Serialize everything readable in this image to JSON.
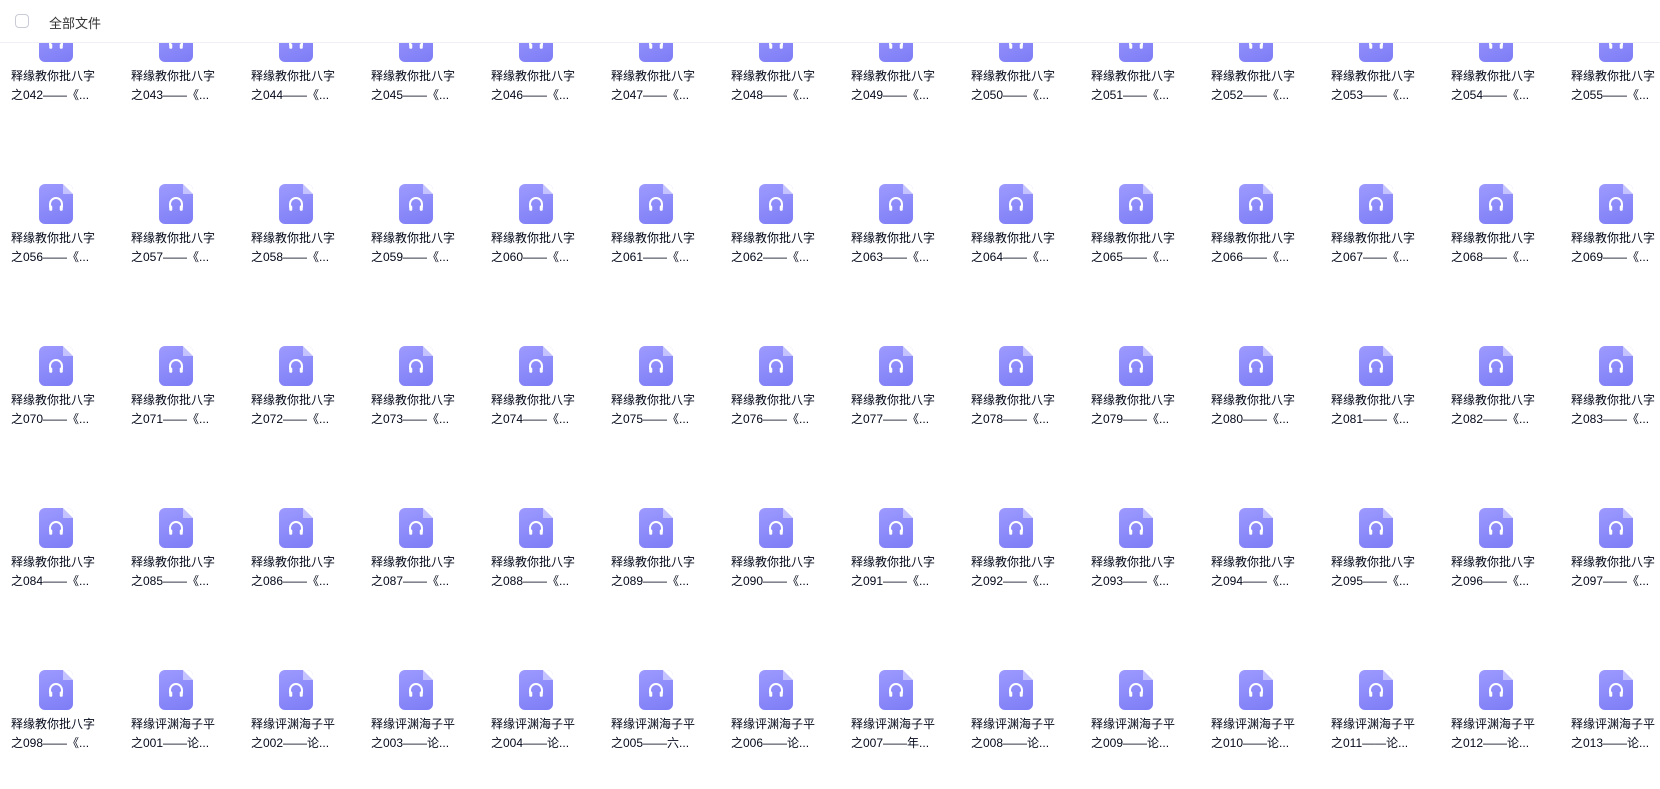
{
  "header": {
    "title": "全部文件"
  },
  "icon_name": "headphones-audio-icon",
  "colors": {
    "icon": "#8a89fb",
    "text": "#03081a",
    "border": "#eef0f5"
  },
  "files": [
    {
      "l1": "释缘教你批八字",
      "l2": "之042——《..."
    },
    {
      "l1": "释缘教你批八字",
      "l2": "之043——《..."
    },
    {
      "l1": "释缘教你批八字",
      "l2": "之044——《..."
    },
    {
      "l1": "释缘教你批八字",
      "l2": "之045——《..."
    },
    {
      "l1": "释缘教你批八字",
      "l2": "之046——《..."
    },
    {
      "l1": "释缘教你批八字",
      "l2": "之047——《..."
    },
    {
      "l1": "释缘教你批八字",
      "l2": "之048——《..."
    },
    {
      "l1": "释缘教你批八字",
      "l2": "之049——《..."
    },
    {
      "l1": "释缘教你批八字",
      "l2": "之050——《..."
    },
    {
      "l1": "释缘教你批八字",
      "l2": "之051——《..."
    },
    {
      "l1": "释缘教你批八字",
      "l2": "之052——《..."
    },
    {
      "l1": "释缘教你批八字",
      "l2": "之053——《..."
    },
    {
      "l1": "释缘教你批八字",
      "l2": "之054——《..."
    },
    {
      "l1": "释缘教你批八字",
      "l2": "之055——《..."
    },
    {
      "l1": "释缘教你批八字",
      "l2": "之056——《..."
    },
    {
      "l1": "释缘教你批八字",
      "l2": "之057——《..."
    },
    {
      "l1": "释缘教你批八字",
      "l2": "之058——《..."
    },
    {
      "l1": "释缘教你批八字",
      "l2": "之059——《..."
    },
    {
      "l1": "释缘教你批八字",
      "l2": "之060——《..."
    },
    {
      "l1": "释缘教你批八字",
      "l2": "之061——《..."
    },
    {
      "l1": "释缘教你批八字",
      "l2": "之062——《..."
    },
    {
      "l1": "释缘教你批八字",
      "l2": "之063——《..."
    },
    {
      "l1": "释缘教你批八字",
      "l2": "之064——《..."
    },
    {
      "l1": "释缘教你批八字",
      "l2": "之065——《..."
    },
    {
      "l1": "释缘教你批八字",
      "l2": "之066——《..."
    },
    {
      "l1": "释缘教你批八字",
      "l2": "之067——《..."
    },
    {
      "l1": "释缘教你批八字",
      "l2": "之068——《..."
    },
    {
      "l1": "释缘教你批八字",
      "l2": "之069——《..."
    },
    {
      "l1": "释缘教你批八字",
      "l2": "之070——《..."
    },
    {
      "l1": "释缘教你批八字",
      "l2": "之071——《..."
    },
    {
      "l1": "释缘教你批八字",
      "l2": "之072——《..."
    },
    {
      "l1": "释缘教你批八字",
      "l2": "之073——《..."
    },
    {
      "l1": "释缘教你批八字",
      "l2": "之074——《..."
    },
    {
      "l1": "释缘教你批八字",
      "l2": "之075——《..."
    },
    {
      "l1": "释缘教你批八字",
      "l2": "之076——《..."
    },
    {
      "l1": "释缘教你批八字",
      "l2": "之077——《..."
    },
    {
      "l1": "释缘教你批八字",
      "l2": "之078——《..."
    },
    {
      "l1": "释缘教你批八字",
      "l2": "之079——《..."
    },
    {
      "l1": "释缘教你批八字",
      "l2": "之080——《..."
    },
    {
      "l1": "释缘教你批八字",
      "l2": "之081——《..."
    },
    {
      "l1": "释缘教你批八字",
      "l2": "之082——《..."
    },
    {
      "l1": "释缘教你批八字",
      "l2": "之083——《..."
    },
    {
      "l1": "释缘教你批八字",
      "l2": "之084——《..."
    },
    {
      "l1": "释缘教你批八字",
      "l2": "之085——《..."
    },
    {
      "l1": "释缘教你批八字",
      "l2": "之086——《..."
    },
    {
      "l1": "释缘教你批八字",
      "l2": "之087——《..."
    },
    {
      "l1": "释缘教你批八字",
      "l2": "之088——《..."
    },
    {
      "l1": "释缘教你批八字",
      "l2": "之089——《..."
    },
    {
      "l1": "释缘教你批八字",
      "l2": "之090——《..."
    },
    {
      "l1": "释缘教你批八字",
      "l2": "之091——《..."
    },
    {
      "l1": "释缘教你批八字",
      "l2": "之092——《..."
    },
    {
      "l1": "释缘教你批八字",
      "l2": "之093——《..."
    },
    {
      "l1": "释缘教你批八字",
      "l2": "之094——《..."
    },
    {
      "l1": "释缘教你批八字",
      "l2": "之095——《..."
    },
    {
      "l1": "释缘教你批八字",
      "l2": "之096——《..."
    },
    {
      "l1": "释缘教你批八字",
      "l2": "之097——《..."
    },
    {
      "l1": "释缘教你批八字",
      "l2": "之098——《..."
    },
    {
      "l1": "释缘评渊海子平",
      "l2": "之001——论..."
    },
    {
      "l1": "释缘评渊海子平",
      "l2": "之002——论..."
    },
    {
      "l1": "释缘评渊海子平",
      "l2": "之003——论..."
    },
    {
      "l1": "释缘评渊海子平",
      "l2": "之004——论..."
    },
    {
      "l1": "释缘评渊海子平",
      "l2": "之005——六..."
    },
    {
      "l1": "释缘评渊海子平",
      "l2": "之006——论..."
    },
    {
      "l1": "释缘评渊海子平",
      "l2": "之007——年..."
    },
    {
      "l1": "释缘评渊海子平",
      "l2": "之008——论..."
    },
    {
      "l1": "释缘评渊海子平",
      "l2": "之009——论..."
    },
    {
      "l1": "释缘评渊海子平",
      "l2": "之010——论..."
    },
    {
      "l1": "释缘评渊海子平",
      "l2": "之011——论..."
    },
    {
      "l1": "释缘评渊海子平",
      "l2": "之012——论..."
    },
    {
      "l1": "释缘评渊海子平",
      "l2": "之013——论..."
    }
  ]
}
